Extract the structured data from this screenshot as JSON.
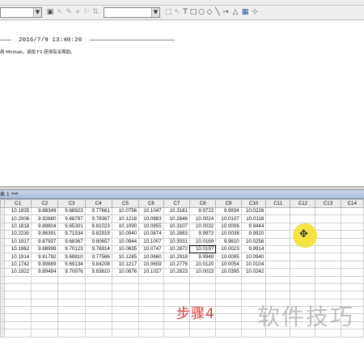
{
  "session": {
    "datetime_line": "———  2016/7/9 13:40:20  ———————————————————————",
    "welcome_line": "用 Minitab，请按 F1 获得有关帮助。"
  },
  "worksheet": {
    "title": "表 1 ***"
  },
  "grid": {
    "columns": [
      "",
      "C1",
      "C2",
      "C3",
      "C4",
      "C5",
      "C6",
      "C7",
      "C8",
      "C9",
      "C10",
      "C11",
      "C12",
      "C13",
      "C14"
    ],
    "rows": [
      [
        "",
        "10.1935",
        "9.88349",
        "9.68923",
        "9.77661",
        "10.0756",
        "10.1047",
        "10.3181",
        "9.9722",
        "9.9934",
        "10.0226",
        "",
        "",
        "",
        ""
      ],
      [
        "",
        "10.2006",
        "9.92680",
        "9.68797",
        "9.78367",
        "10.1218",
        "10.0883",
        "10.2646",
        "10.0024",
        "10.0107",
        "10.0118",
        "",
        "",
        "",
        ""
      ],
      [
        "",
        "10.1818",
        "9.89804",
        "9.65301",
        "9.81023",
        "10.1090",
        "10.0855",
        "10.3107",
        "10.0032",
        "10.0006",
        "9.9444",
        "",
        "",
        "",
        ""
      ],
      [
        "",
        "10.2230",
        "9.86391",
        "9.71534",
        "9.82919",
        "10.0940",
        "10.0874",
        "10.2883",
        "9.9972",
        "10.0038",
        "9.9920",
        "",
        "",
        "",
        ""
      ],
      [
        "",
        "10.1917",
        "9.87937",
        "9.68367",
        "9.80657",
        "10.0944",
        "10.1007",
        "10.3031",
        "10.0169",
        "9.9810",
        "10.0256",
        "",
        "",
        "",
        ""
      ],
      [
        "",
        "10.1962",
        "9.88998",
        "9.70123",
        "9.76914",
        "10.0835",
        "10.0747",
        "10.2872",
        "10.0197",
        "10.0023",
        "9.9914",
        "",
        "",
        "",
        ""
      ],
      [
        "",
        "10.1914",
        "9.91792",
        "9.68810",
        "9.77566",
        "10.1285",
        "10.0660",
        "10.2918",
        "9.9948",
        "10.0095",
        "10.0940",
        "",
        "",
        "",
        ""
      ],
      [
        "",
        "10.1742",
        "9.90889",
        "9.69134",
        "9.84208",
        "10.1217",
        "10.0659",
        "10.2776",
        "10.0120",
        "10.0054",
        "10.0104",
        "",
        "",
        "",
        ""
      ],
      [
        "",
        "10.1922",
        "9.89484",
        "9.70976",
        "9.83610",
        "10.0876",
        "10.1027",
        "10.2823",
        "10.0023",
        "10.0395",
        "10.0242",
        "",
        "",
        "",
        ""
      ],
      [
        "",
        "",
        "",
        "",
        "",
        "",
        "",
        "",
        "",
        "",
        "",
        "",
        "",
        "",
        ""
      ],
      [
        "",
        "",
        "",
        "",
        "",
        "",
        "",
        "",
        "",
        "",
        "",
        "",
        "",
        "",
        ""
      ],
      [
        "",
        "",
        "",
        "",
        "",
        "",
        "",
        "",
        "",
        "",
        "",
        "",
        "",
        "",
        ""
      ],
      [
        "",
        "",
        "",
        "",
        "",
        "",
        "",
        "",
        "",
        "",
        "",
        "",
        "",
        "",
        ""
      ],
      [
        "",
        "",
        "",
        "",
        "",
        "",
        "",
        "",
        "",
        "",
        "",
        "",
        "",
        "",
        ""
      ],
      [
        "",
        "",
        "",
        "",
        "",
        "",
        "",
        "",
        "",
        "",
        "",
        "",
        "",
        "",
        ""
      ],
      [
        "",
        "",
        "",
        "",
        "",
        "",
        "",
        "",
        "",
        "",
        "",
        "",
        "",
        "",
        ""
      ],
      [
        "",
        "",
        "",
        "",
        "",
        "",
        "",
        "",
        "",
        "",
        "",
        "",
        "",
        "",
        ""
      ]
    ],
    "selected_cell": {
      "row": 5,
      "col": 8
    }
  },
  "overlay": {
    "cursor_glyph": "✥",
    "step_label": "步骤4",
    "watermark": "软件技巧"
  },
  "toolbar_icons": [
    "pointer-icon",
    "pencil-icon",
    "plus-icon",
    "flag-icon",
    "arrows-icon",
    "text-icon",
    "rectangle-icon",
    "ellipse-icon",
    "line-icon",
    "arrow-icon"
  ]
}
